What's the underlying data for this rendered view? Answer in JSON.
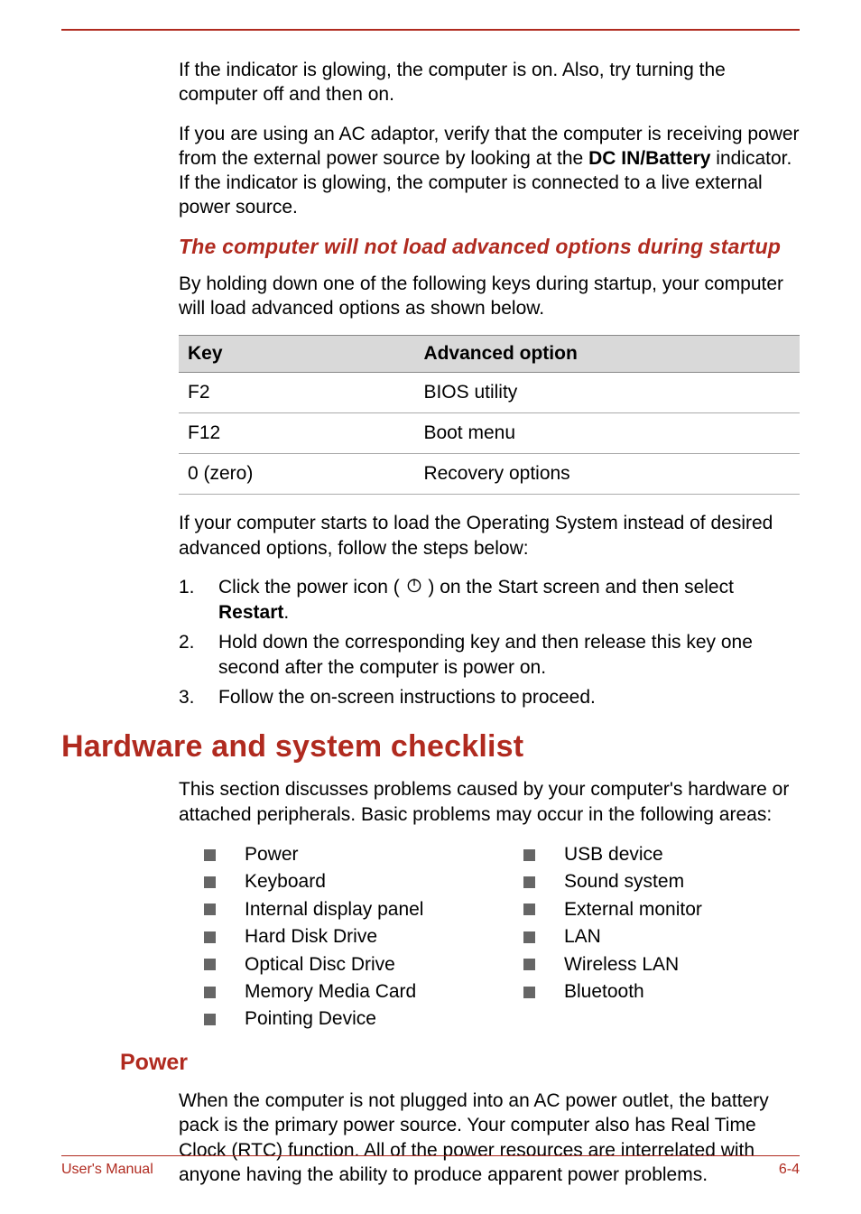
{
  "intro": {
    "p1a": "If the indicator is glowing, the computer is on. Also, try turning the computer off and then on.",
    "p2_pre": "If you are using an AC adaptor, verify that the computer is receiving power from the external power source by looking at the ",
    "p2_bold": "DC IN/Battery",
    "p2_post": " indicator. If the indicator is glowing, the computer is connected to a live external power source."
  },
  "section_startup": {
    "heading": "The computer will not load advanced options during startup",
    "lead": "By holding down one of the following keys during startup, your computer will load advanced options as shown below.",
    "table": {
      "headers": {
        "key": "Key",
        "option": "Advanced option"
      },
      "rows": [
        {
          "key": "F2",
          "option": "BIOS utility"
        },
        {
          "key": "F12",
          "option": "Boot menu"
        },
        {
          "key": "0 (zero)",
          "option": "Recovery options"
        }
      ]
    },
    "after_table": "If your computer starts to load the Operating System instead of desired advanced options, follow the steps below:",
    "steps": {
      "s1_pre": "Click the power icon ( ",
      "s1_post": " ) on the Start screen and then select ",
      "s1_bold": "Restart",
      "s1_end": ".",
      "s2": "Hold down the corresponding key and then release this key one second after the computer is power on.",
      "s3": "Follow the on-screen instructions to proceed."
    }
  },
  "hw": {
    "heading": "Hardware and system checklist",
    "lead": "This section discusses problems caused by your computer's hardware or attached peripherals. Basic problems may occur in the following areas:",
    "left": [
      "Power",
      "Keyboard",
      "Internal display panel",
      "Hard Disk Drive",
      "Optical Disc Drive",
      "Memory Media Card",
      "Pointing Device"
    ],
    "right": [
      "USB device",
      "Sound system",
      "External monitor",
      "LAN",
      "Wireless LAN",
      "Bluetooth"
    ]
  },
  "power": {
    "heading": "Power",
    "para": "When the computer is not plugged into an AC power outlet, the battery pack is the primary power source. Your computer also has Real Time Clock (RTC) function. All of the power resources are interrelated with anyone having the ability to produce apparent power problems."
  },
  "footer": {
    "left": "User's Manual",
    "right": "6-4"
  }
}
